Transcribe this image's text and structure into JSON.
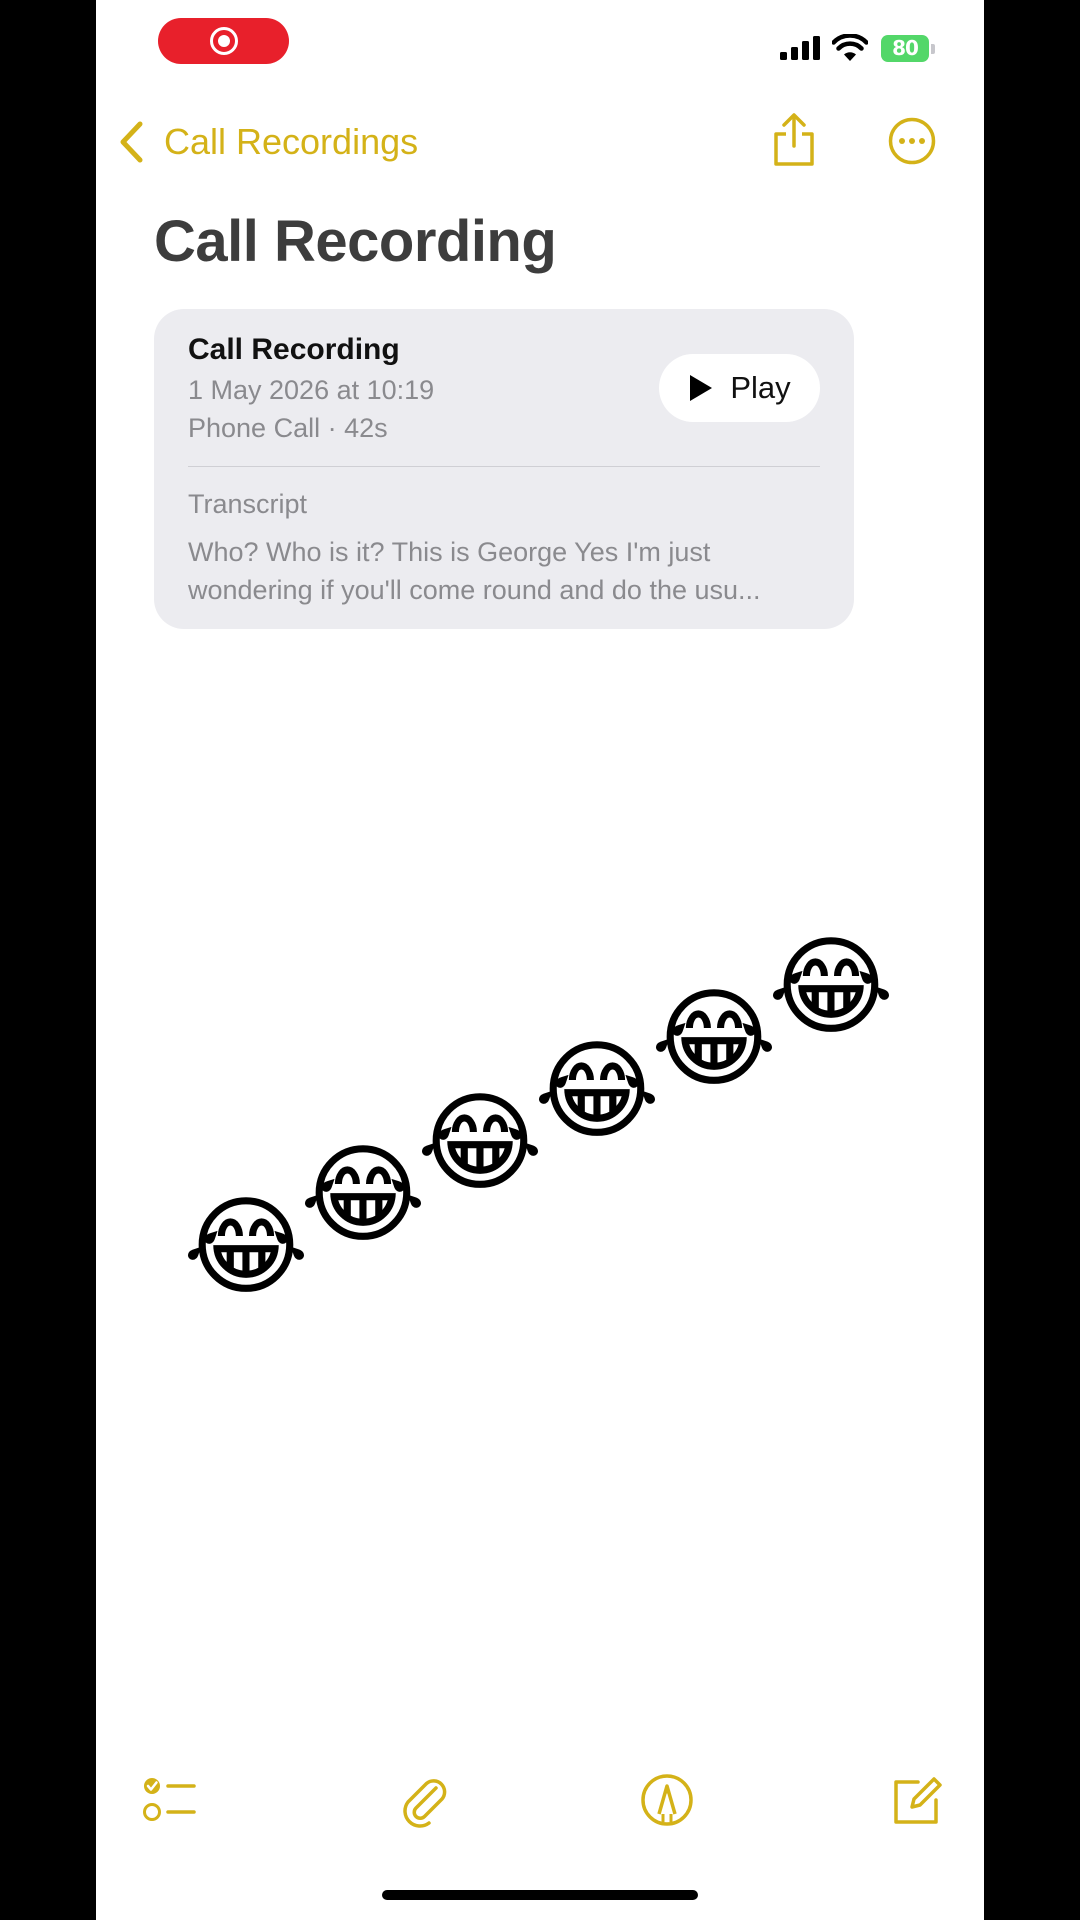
{
  "status_bar": {
    "recording_indicator": "record-icon",
    "battery_level": "80",
    "icons": [
      "cellular-signal-icon",
      "wifi-icon",
      "battery-charging-icon"
    ]
  },
  "nav": {
    "back_label": "Call Recordings",
    "back_icon": "chevron-left-icon",
    "actions": [
      "share-icon",
      "more-icon"
    ]
  },
  "note": {
    "title": "Call Recording"
  },
  "recording_card": {
    "title": "Call Recording",
    "date": "1 May 2026 at 10:19",
    "meta": "Phone Call · 42s",
    "play_label": "Play",
    "transcript_label": "Transcript",
    "transcript_text": "Who? Who is it? This is George Yes I'm just wondering if you'll come round and do the usu..."
  },
  "emoji_row": {
    "emoji": "😂",
    "count": 6
  },
  "toolbar": {
    "items": [
      "checklist-icon",
      "attachment-icon",
      "markup-icon",
      "compose-icon"
    ]
  },
  "colors": {
    "accent": "#d4b218",
    "recording": "#e8202b",
    "battery": "#53d769",
    "card_bg": "#ececf0",
    "title_text": "#3d3d3d",
    "secondary_text": "#8a8a8e"
  }
}
